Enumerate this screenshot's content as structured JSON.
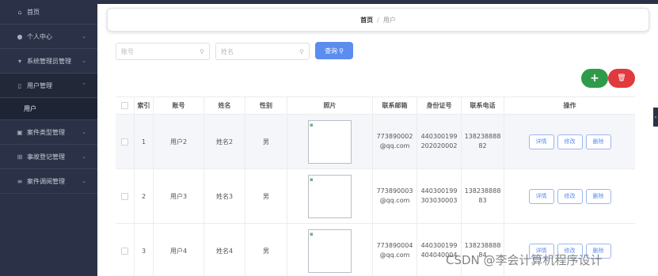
{
  "sidebar": {
    "items": [
      {
        "label": "首页",
        "icon": "home-icon"
      },
      {
        "label": "个人中心",
        "icon": "user-icon"
      },
      {
        "label": "系统管理员管理",
        "icon": "admin-icon"
      },
      {
        "label": "用户管理",
        "icon": "user-outline-icon",
        "sub": "用户"
      },
      {
        "label": "案件类型管理",
        "icon": "folder-icon"
      },
      {
        "label": "事故登记管理",
        "icon": "grid-icon"
      },
      {
        "label": "案件调阅管理",
        "icon": "list-icon"
      }
    ]
  },
  "breadcrumb": {
    "home": "首页",
    "sep": "/",
    "current": "用户"
  },
  "search": {
    "account_placeholder": "账号",
    "name_placeholder": "姓名",
    "query_label": "查询"
  },
  "actions": {
    "add": "+",
    "delete": "🗑"
  },
  "table": {
    "headers": [
      "索引",
      "账号",
      "姓名",
      "性别",
      "照片",
      "联系邮箱",
      "身份证号",
      "联系电话",
      "操作"
    ],
    "rows": [
      {
        "index": "1",
        "account": "用户2",
        "name": "姓名2",
        "gender": "男",
        "email1": "773890002",
        "email2": "@qq.com",
        "id1": "440300199",
        "id2": "202020002",
        "phone1": "138238888",
        "phone2": "82"
      },
      {
        "index": "2",
        "account": "用户3",
        "name": "姓名3",
        "gender": "男",
        "email1": "773890003",
        "email2": "@qq.com",
        "id1": "440300199",
        "id2": "303030003",
        "phone1": "138238888",
        "phone2": "83"
      },
      {
        "index": "3",
        "account": "用户4",
        "name": "姓名4",
        "gender": "男",
        "email1": "773890004",
        "email2": "@qq.com",
        "id1": "440300199",
        "id2": "404040004",
        "phone1": "138238888",
        "phone2": "84"
      }
    ],
    "op_labels": {
      "detail": "详情",
      "edit": "修改",
      "delete": "删除"
    }
  },
  "watermark": "CSDN @李会计算机程序设计"
}
